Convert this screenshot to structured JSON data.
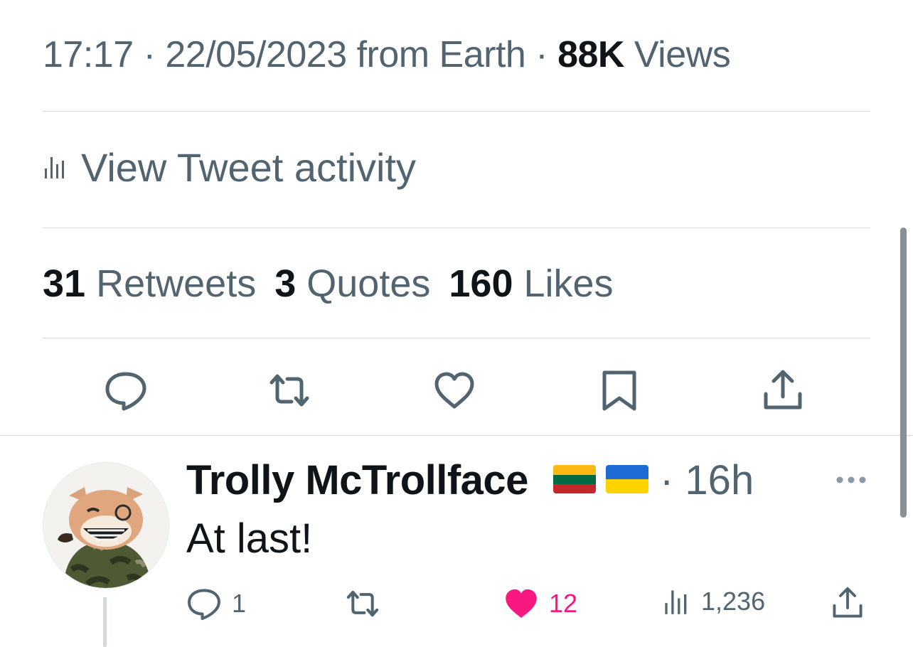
{
  "tweet": {
    "meta": {
      "time": "17:17",
      "sep1": "·",
      "date": "22/05/2023",
      "from": "from Earth",
      "sep2": "·",
      "views_count": "88K",
      "views_label": "Views"
    },
    "activity_label": "View Tweet activity",
    "stats": {
      "retweets_count": "31",
      "retweets_label": "Retweets",
      "quotes_count": "3",
      "quotes_label": "Quotes",
      "likes_count": "160",
      "likes_label": "Likes"
    },
    "actions": [
      "reply-icon",
      "retweet-icon",
      "like-icon",
      "bookmark-icon",
      "share-icon"
    ]
  },
  "reply": {
    "name": "Trolly McTrollface",
    "flags": [
      "Lithuania",
      "Ukraine"
    ],
    "time": "· 16h",
    "more_icon": "more-icon",
    "text": "At last!",
    "replies_count": "1",
    "likes_count": "12",
    "views_count": "1,236"
  },
  "colors": {
    "text_primary": "#0f1419",
    "text_secondary": "#536471",
    "divider": "#d6dbdf",
    "like_active": "#f91880"
  }
}
